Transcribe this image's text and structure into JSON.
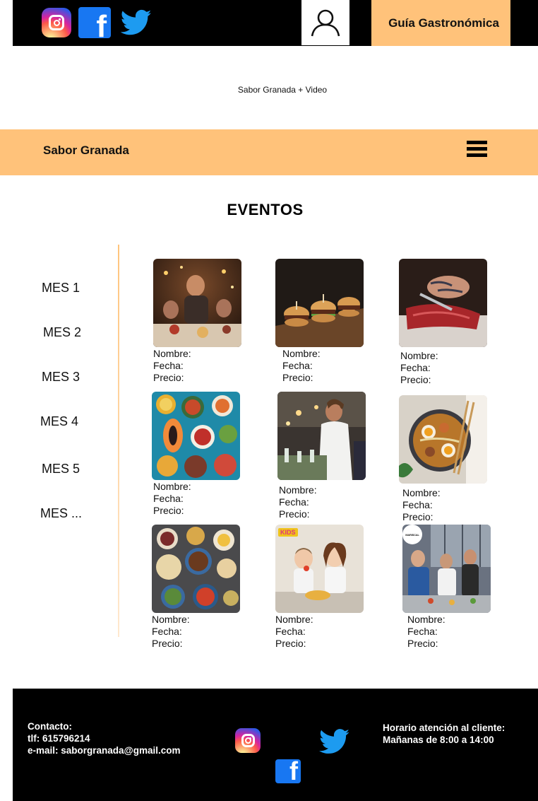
{
  "header": {
    "guide_button": "Guía Gastronómica",
    "video_label": "Sabor Granada + Video",
    "icons": [
      "instagram-icon",
      "facebook-icon",
      "twitter-icon",
      "user-icon"
    ]
  },
  "nav": {
    "brand": "Sabor Granada",
    "menu_icon": "hamburger-menu-icon"
  },
  "main": {
    "title": "EVENTOS",
    "months": [
      "MES 1",
      "MES 2",
      "MES 3",
      "MES 4",
      "MES 5",
      "MES ..."
    ],
    "field_labels": {
      "name": "Nombre:",
      "date": "Fecha:",
      "price": "Precio:"
    },
    "events": [
      {
        "image": "christmas-dinner-photo"
      },
      {
        "image": "mini-burgers-photo"
      },
      {
        "image": "tuna-cutting-photo"
      },
      {
        "image": "colorful-dishes-photo"
      },
      {
        "image": "chef-serving-photo"
      },
      {
        "image": "ramen-bowl-photo"
      },
      {
        "image": "mezze-table-photo"
      },
      {
        "image": "kids-cooking-photo",
        "badge": "KIDS"
      },
      {
        "image": "cooking-class-photo",
        "badge": "MARISCAL"
      }
    ]
  },
  "footer": {
    "contact_title": "Contacto:",
    "phone": "tlf: 615796214",
    "email": "e-mail: saborgranada@gmail.com",
    "hours_title": "Horario atención al cliente:",
    "hours": "Mañanas de 8:00 a 14:00"
  },
  "colors": {
    "accent": "#ffc27a",
    "dark": "#000000",
    "facebook": "#1877f2",
    "twitter": "#1d9bf0"
  }
}
